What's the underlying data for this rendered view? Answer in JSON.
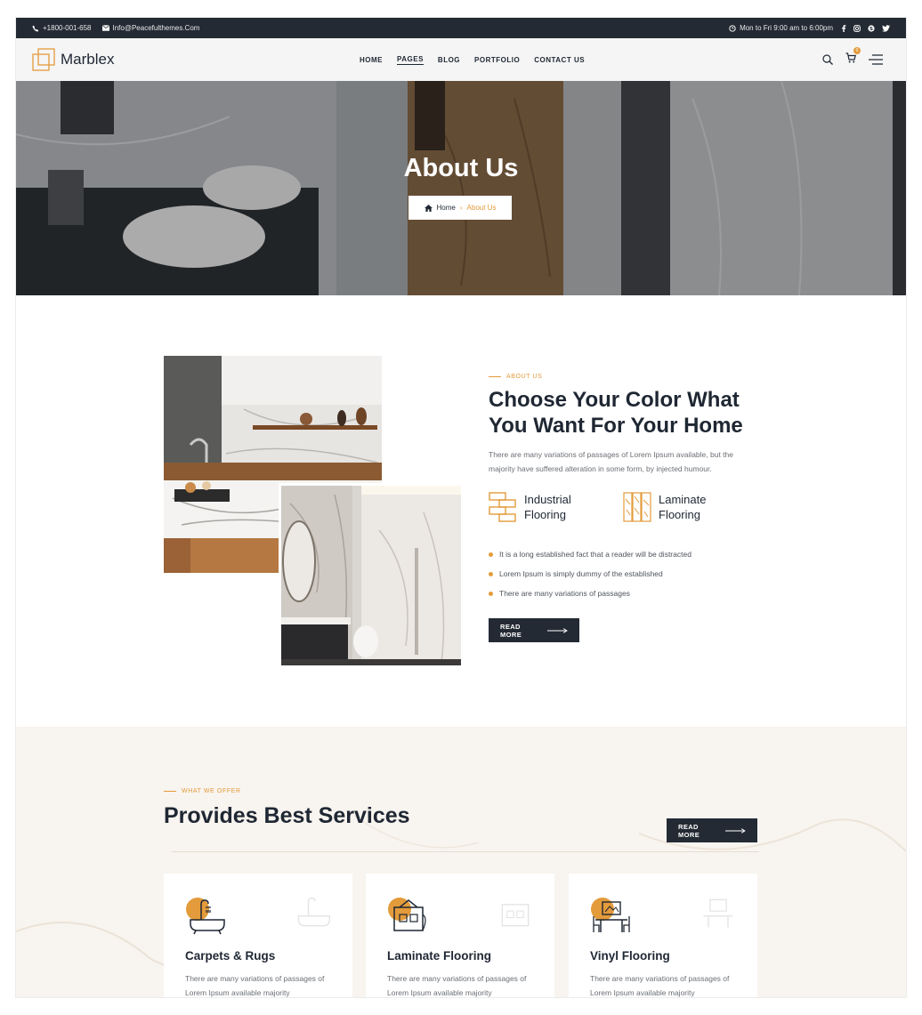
{
  "topbar": {
    "phone": "+1800-001-658",
    "email": "Info@Peacefulthemes.Com",
    "hours": "Mon to Fri 9:00 am to 6:00pm",
    "social_icons": [
      "facebook-icon",
      "instagram-icon",
      "skype-icon",
      "twitter-icon"
    ]
  },
  "header": {
    "logo_text": "Marblex",
    "nav": [
      "HOME",
      "PAGES",
      "BLOG",
      "PORTFOLIO",
      "CONTACT US"
    ],
    "active_nav": "PAGES",
    "cart_count": "0"
  },
  "hero": {
    "title": "About Us",
    "breadcrumb_home": "Home",
    "breadcrumb_current": "About Us"
  },
  "about": {
    "eyebrow": "ABOUT US",
    "title": "Choose Your Color What You Want For Your Home",
    "description": "There are many variations of passages of Lorem Ipsum available, but the majority have suffered alteration in some form, by injected humour.",
    "features": [
      "Industrial Flooring",
      "Laminate Flooring"
    ],
    "bullets": [
      "It is a long established fact that a reader will be distracted",
      "Lorem Ipsum is simply dummy of the established",
      "There are many variations of passages"
    ],
    "button": "READ MORE"
  },
  "services": {
    "eyebrow": "WHAT WE OFFER",
    "title": "Provides Best Services",
    "button": "READ MORE",
    "cards": [
      {
        "title": "Carpets & Rugs",
        "description": "There are many variations of passages of Lorem Ipsum available majority"
      },
      {
        "title": "Laminate Flooring",
        "description": "There are many variations of passages of Lorem Ipsum available majority"
      },
      {
        "title": "Vinyl Flooring",
        "description": "There are many variations of passages of Lorem Ipsum available majority"
      }
    ]
  },
  "colors": {
    "accent": "#e39b3b",
    "dark": "#232a34",
    "section_bg": "#f8f4ef"
  }
}
